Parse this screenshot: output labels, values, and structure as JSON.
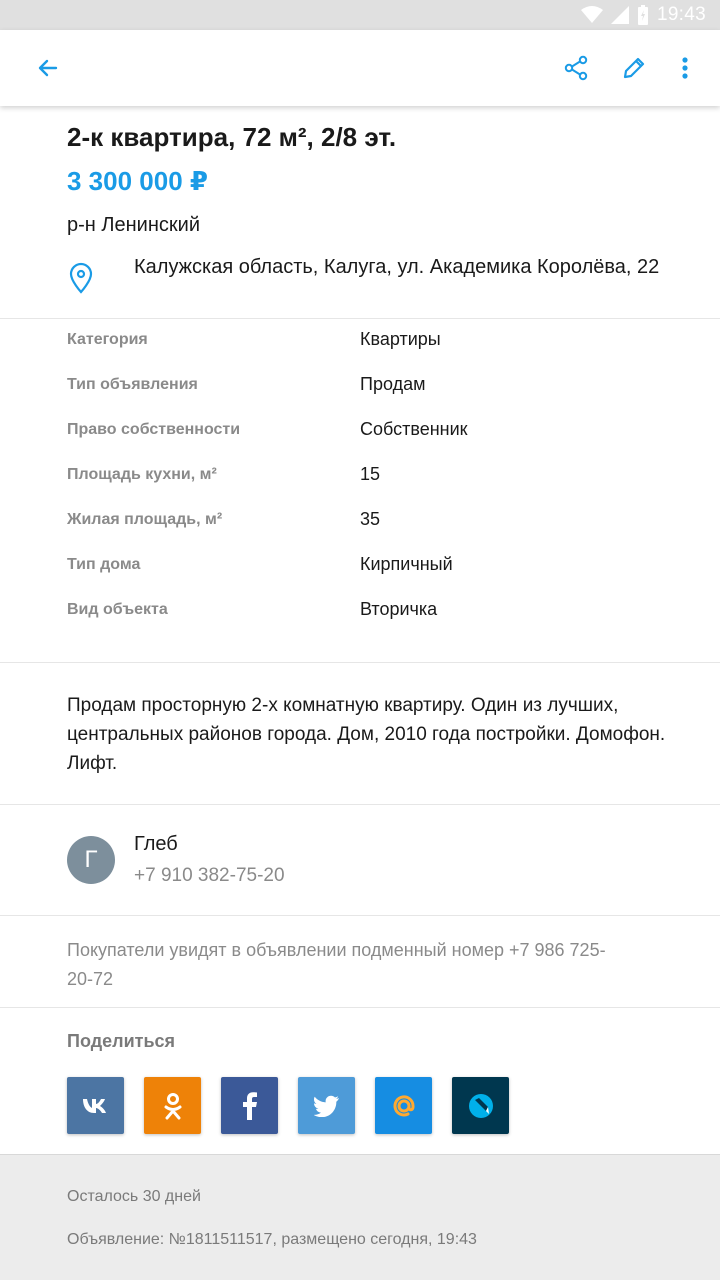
{
  "status_bar": {
    "time": "19:43",
    "icons": [
      "wifi-icon",
      "signal-icon",
      "battery-icon"
    ]
  },
  "toolbar": {
    "icons": [
      "back-arrow-icon",
      "share-icon",
      "edit-pencil-icon",
      "more-vert-icon"
    ]
  },
  "listing": {
    "title": "2-к квартира, 72 м², 2/8 эт.",
    "price": "3 300 000 ₽",
    "district": "р-н Ленинский",
    "address": "Калужская область, Калуга, ул. Академика Королёва, 22"
  },
  "params": [
    {
      "key": "Категория",
      "value": "Квартиры"
    },
    {
      "key": "Тип объявления",
      "value": "Продам"
    },
    {
      "key": "Право собственности",
      "value": "Собственник"
    },
    {
      "key": "Площадь кухни, м²",
      "value": "15"
    },
    {
      "key": "Жилая площадь, м²",
      "value": "35"
    },
    {
      "key": "Тип дома",
      "value": "Кирпичный"
    },
    {
      "key": "Вид объекта",
      "value": "Вторичка"
    }
  ],
  "description": "Продам просторную 2-х комнатную квартиру. Один из лучших, центральных районов города. Дом, 2010 года постройки. Домофон. Лифт.",
  "seller": {
    "initial": "Г",
    "name": "Глеб",
    "phone": "+7 910 382-75-20"
  },
  "substitute_note": "Покупатели увидят в объявлении подменный номер +7 986 725-20-72",
  "share": {
    "heading": "Поделиться",
    "networks": [
      {
        "name": "vk-icon",
        "color": "#4c75a3"
      },
      {
        "name": "odnoklassniki-icon",
        "color": "#ee8208"
      },
      {
        "name": "facebook-icon",
        "color": "#3b5998"
      },
      {
        "name": "twitter-icon",
        "color": "#4e9bd8"
      },
      {
        "name": "mailru-icon",
        "color": "#168de2"
      },
      {
        "name": "livejournal-icon",
        "color": "#00374f"
      }
    ]
  },
  "footer": {
    "days_left": "Осталось 30 дней",
    "ad_info": "Объявление: №1811511517, размещено сегодня, 19:43"
  },
  "colors": {
    "accent": "#1a9be6",
    "secondary_text": "#8a8a8a",
    "avatar": "#7d8f9c"
  }
}
